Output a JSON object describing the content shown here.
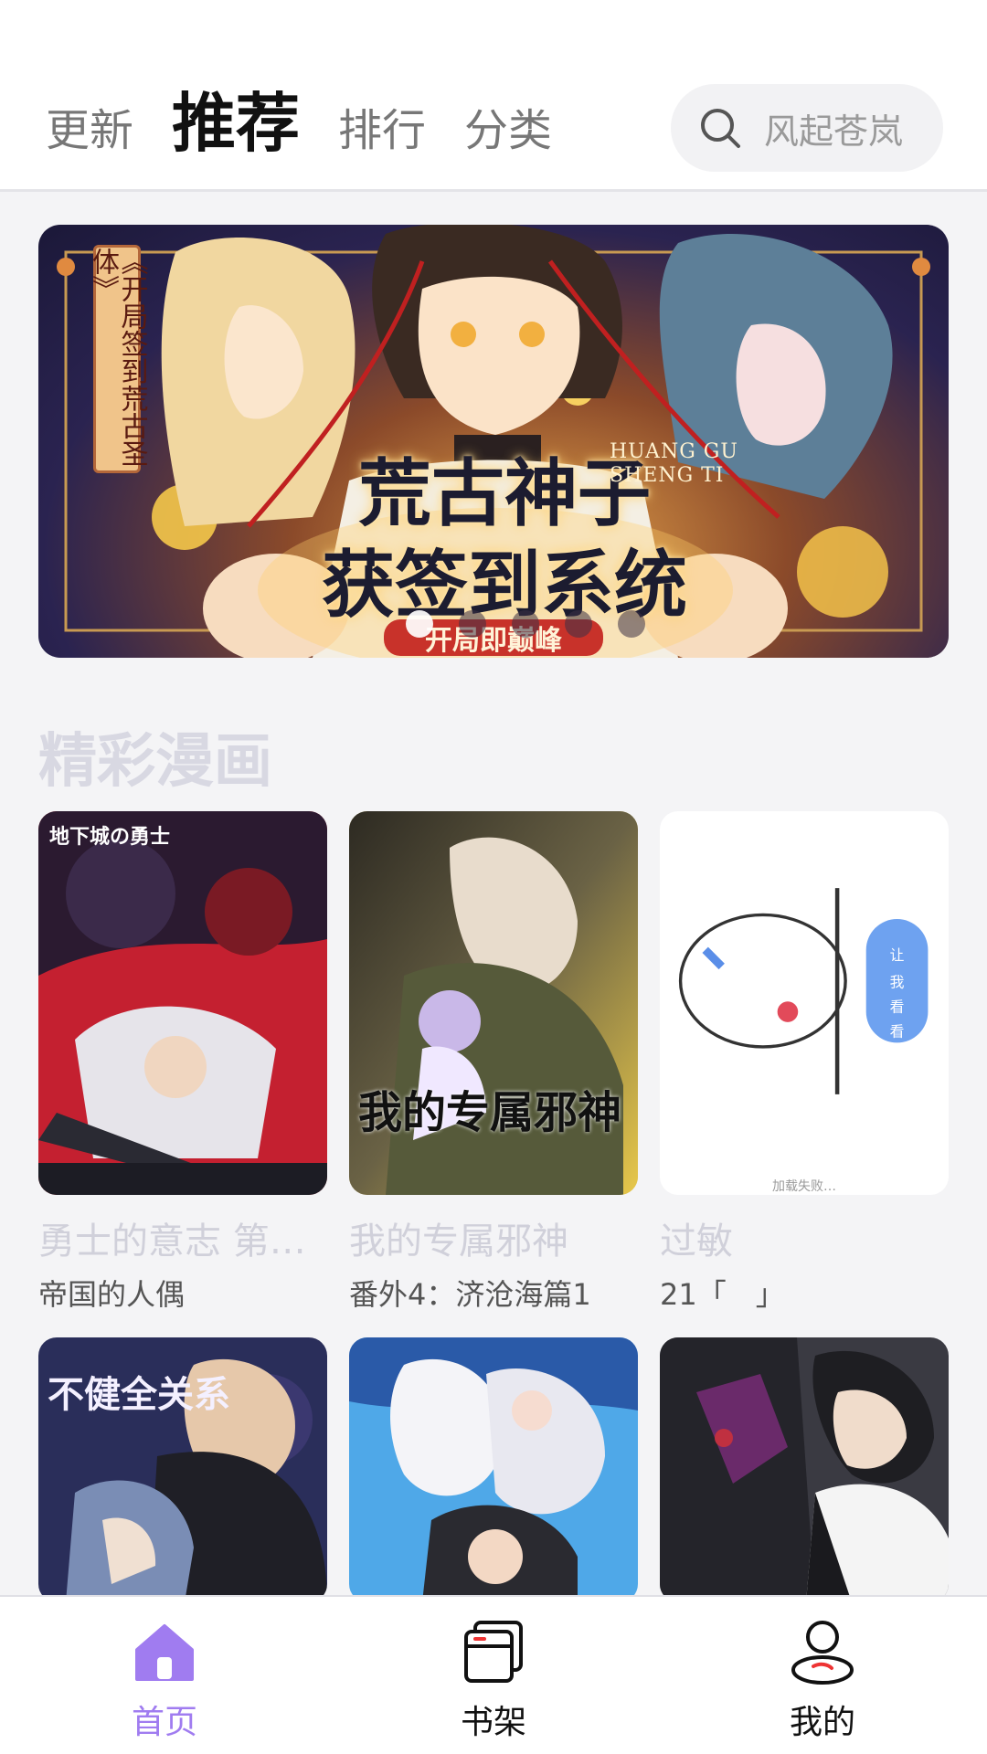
{
  "header": {
    "tabs": [
      {
        "label": "更新",
        "active": false
      },
      {
        "label": "推荐",
        "active": true
      },
      {
        "label": "排行",
        "active": false
      },
      {
        "label": "分类",
        "active": false
      }
    ],
    "search": {
      "placeholder": "风起苍岚",
      "icon": "search-icon"
    }
  },
  "banner": {
    "side_title": "《开局签到荒古圣体》",
    "title_line1": "荒古神子",
    "title_line2": "获签到系统",
    "pinyin": "HUANG GU\nSHENG TI",
    "ribbon": "开局即巅峰",
    "dots_total": 5,
    "active_dot": 0
  },
  "section": {
    "title": "精彩漫画"
  },
  "comics": [
    {
      "title": "勇士的意志 第…",
      "subtitle": "帝国的人偶",
      "cover_text": "地下城の勇士"
    },
    {
      "title": "我的专属邪神",
      "subtitle": "番外4：济沧海篇1",
      "cover_text": "我的专属邪神"
    },
    {
      "title": "过敏",
      "subtitle": "21「　」",
      "failed_text": "加载失败…",
      "bubble_text": "让我看看"
    },
    {
      "title": "",
      "subtitle": "",
      "cover_text": "不健全关系"
    },
    {
      "title": "",
      "subtitle": ""
    },
    {
      "title": "",
      "subtitle": ""
    }
  ],
  "bottom_nav": [
    {
      "label": "首页",
      "icon": "home-icon",
      "active": true
    },
    {
      "label": "书架",
      "icon": "bookshelf-icon",
      "active": false
    },
    {
      "label": "我的",
      "icon": "profile-icon",
      "active": false
    }
  ],
  "colors": {
    "accent": "#a07cf0",
    "tab_active": "#111111",
    "tab_inactive": "#777777"
  }
}
